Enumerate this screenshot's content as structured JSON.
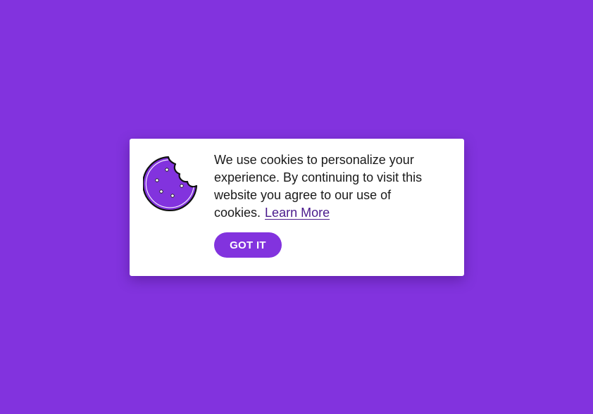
{
  "cookie_banner": {
    "icon": "cookie-icon",
    "message": "We use cookies to personalize your experience. By continuing to visit this website you agree to our use of cookies.",
    "learn_more_label": "Learn More",
    "accept_label": "GOT IT"
  },
  "colors": {
    "background": "#8233DE",
    "card": "#FFFFFF",
    "accent": "#8233DE",
    "link": "#4A1A8C"
  }
}
